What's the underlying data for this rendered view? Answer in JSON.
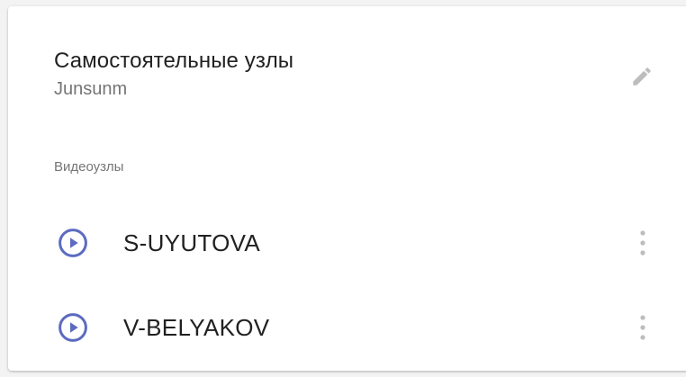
{
  "card": {
    "title": "Самостоятельные узлы",
    "subtitle": "Junsunm"
  },
  "icons": {
    "edit": "pencil-icon",
    "play": "play-circle-icon",
    "menu": "more-vertical-icon"
  },
  "colors": {
    "accent": "#5c6bc0",
    "icon_gray": "#bdbdbd"
  },
  "section": {
    "label": "Видеоузлы"
  },
  "nodes": [
    {
      "name": "S-UYUTOVA"
    },
    {
      "name": "V-BELYAKOV"
    }
  ]
}
